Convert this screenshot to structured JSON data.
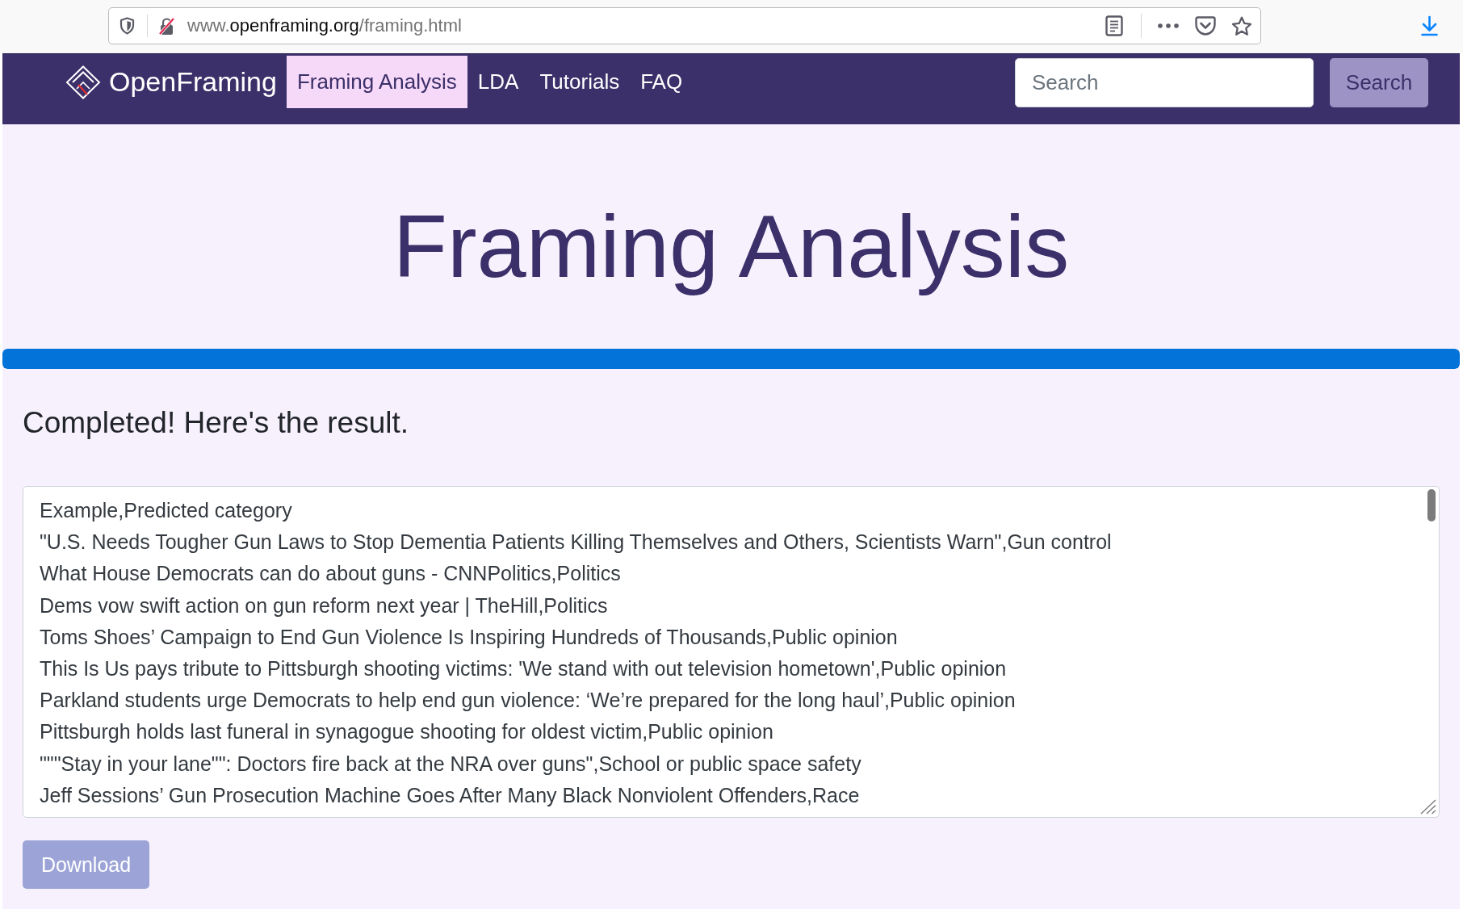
{
  "browser": {
    "url": {
      "subdomain": "www.",
      "domain": "openframing.org",
      "path": "/framing.html"
    }
  },
  "navbar": {
    "brand": "OpenFraming",
    "items": [
      {
        "label": "Framing Analysis",
        "selected": true
      },
      {
        "label": "LDA",
        "selected": false
      },
      {
        "label": "Tutorials",
        "selected": false
      },
      {
        "label": "FAQ",
        "selected": false
      }
    ],
    "search": {
      "placeholder": "Search"
    },
    "search_button": "Search"
  },
  "page": {
    "title": "Framing Analysis",
    "progress": {
      "level": 1
    },
    "status": "Completed! Here's the result.",
    "result_lines": [
      "Example,Predicted category",
      "\"U.S. Needs Tougher Gun Laws to Stop Dementia Patients Killing Themselves and Others, Scientists Warn\",Gun control",
      "What House Democrats can do about guns - CNNPolitics,Politics",
      "Dems vow swift action on gun reform next year | TheHill,Politics",
      "Toms Shoes’ Campaign to End Gun Violence Is Inspiring Hundreds of Thousands,Public opinion",
      "This Is Us pays tribute to Pittsburgh shooting victims: 'We stand with out television hometown',Public opinion",
      "Parkland students urge Democrats to help end gun violence: ‘We’re prepared for the long haul’,Public opinion",
      "Pittsburgh holds last funeral in synagogue shooting for oldest victim,Public opinion",
      "\"\"\"Stay in your lane\"\": Doctors fire back at the NRA over guns\",School or public space safety",
      "Jeff Sessions’ Gun Prosecution Machine Goes After Many Black Nonviolent Offenders,Race"
    ],
    "download_button": "Download"
  }
}
